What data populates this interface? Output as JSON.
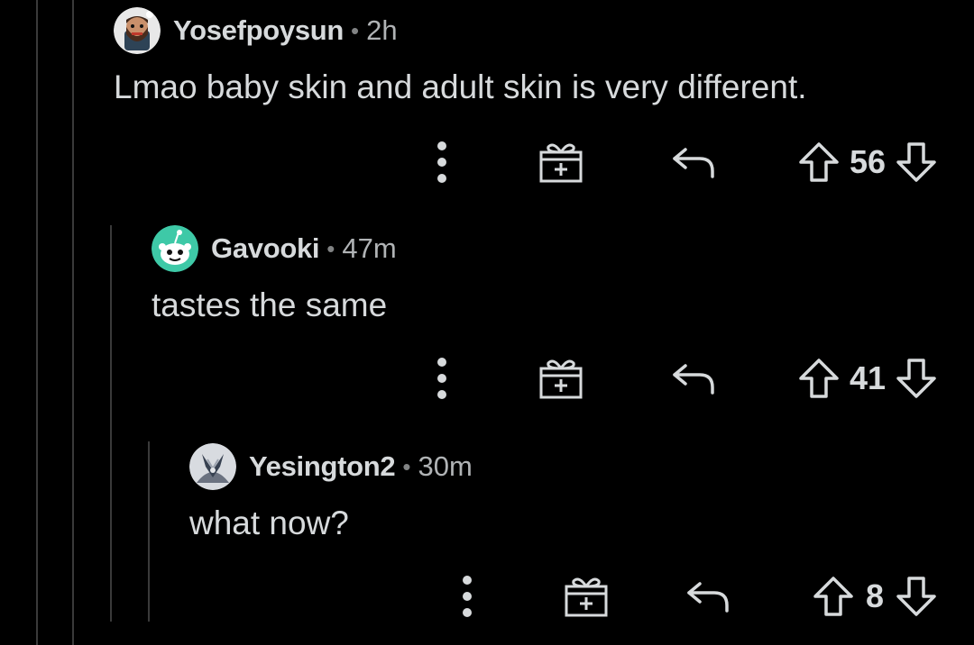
{
  "comments": [
    {
      "username": "Yosefpoysun",
      "separator": "•",
      "time": "2h",
      "text": "Lmao baby skin and adult skin is very different.",
      "score": "56",
      "avatar_icon": "bearded-man-avatar"
    },
    {
      "username": "Gavooki",
      "separator": "•",
      "time": "47m",
      "text": "tastes the same",
      "score": "41",
      "avatar_icon": "snoo-avatar"
    },
    {
      "username": "Yesington2",
      "separator": "•",
      "time": "30m",
      "text": "what now?",
      "score": "8",
      "avatar_icon": "robot-avatar"
    }
  ],
  "icons": {
    "more": "more-vertical-icon",
    "award": "gift-icon",
    "reply": "reply-arrow-icon",
    "upvote": "upvote-arrow-icon",
    "downvote": "downvote-arrow-icon"
  },
  "colors": {
    "background": "#000000",
    "text": "#d7dadc",
    "muted": "#b0b3b5",
    "thread_line": "#3a3a3a",
    "snoo_accent": "#3ec9a7"
  }
}
